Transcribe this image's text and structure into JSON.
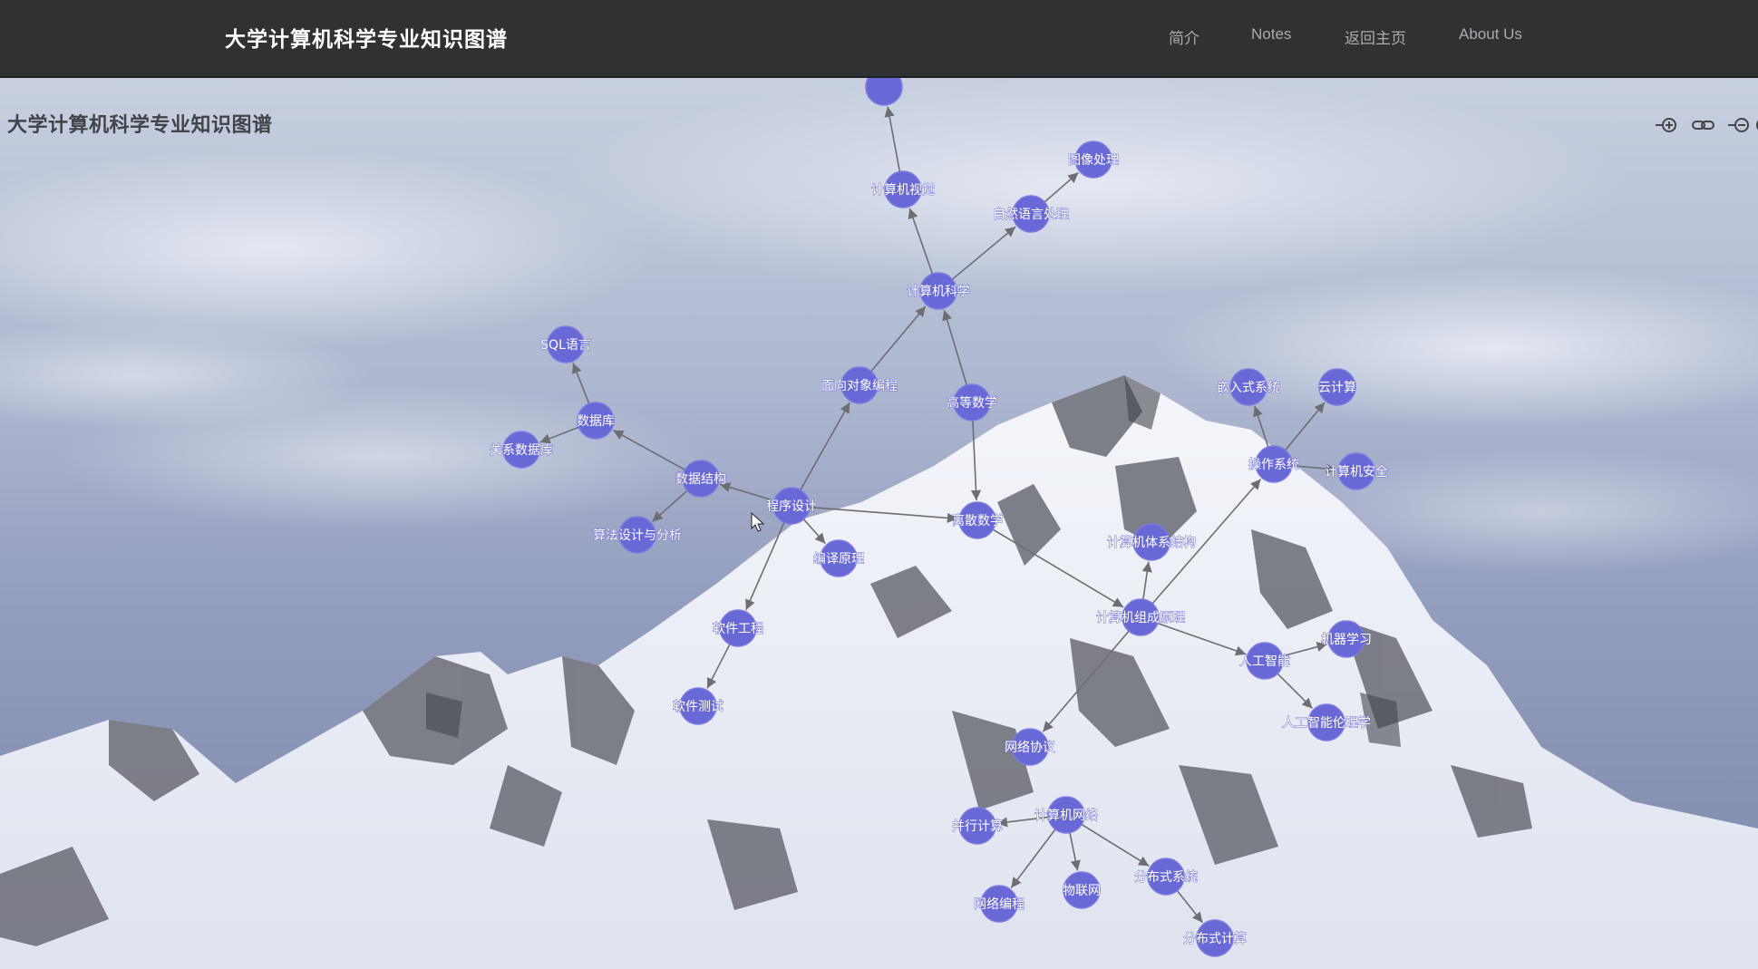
{
  "navbar": {
    "brand": "大学计算机科学专业知识图谱",
    "links": [
      "简介",
      "Notes",
      "返回主页",
      "About Us"
    ]
  },
  "page_title": "大学计算机科学专业知识图谱",
  "toolbar": {
    "icons": [
      "zoom-in-icon",
      "link-icon",
      "zoom-out-icon"
    ]
  },
  "theme": {
    "navbar_bg": "#2f3133",
    "node_color": "#6868d6",
    "edge_color": "#6d6e72"
  },
  "graph": {
    "nodes": [
      {
        "id": "cv_top",
        "label": ""
      },
      {
        "id": "cv",
        "label": "计算机视觉"
      },
      {
        "id": "img",
        "label": "图像处理"
      },
      {
        "id": "nlp",
        "label": "自然语言处理"
      },
      {
        "id": "cs",
        "label": "计算机科学"
      },
      {
        "id": "sql",
        "label": "SQL语言"
      },
      {
        "id": "db",
        "label": "数据库"
      },
      {
        "id": "rdb",
        "label": "关系数据库"
      },
      {
        "id": "oop",
        "label": "面向对象编程"
      },
      {
        "id": "hmath",
        "label": "高等数学"
      },
      {
        "id": "ds",
        "label": "数据结构"
      },
      {
        "id": "prog",
        "label": "程序设计"
      },
      {
        "id": "algo",
        "label": "算法设计与分析"
      },
      {
        "id": "compiler",
        "label": "编译原理"
      },
      {
        "id": "dmath",
        "label": "离散数学"
      },
      {
        "id": "emb",
        "label": "嵌入式系统"
      },
      {
        "id": "cloud",
        "label": "云计算"
      },
      {
        "id": "os",
        "label": "操作系统"
      },
      {
        "id": "sec",
        "label": "计算机安全"
      },
      {
        "id": "arch",
        "label": "计算机体系结构"
      },
      {
        "id": "se",
        "label": "软件工程"
      },
      {
        "id": "co",
        "label": "计算机组成原理"
      },
      {
        "id": "ml",
        "label": "机器学习"
      },
      {
        "id": "ai",
        "label": "人工智能"
      },
      {
        "id": "aiethics",
        "label": "人工智能伦理学"
      },
      {
        "id": "test",
        "label": "软件测试"
      },
      {
        "id": "proto",
        "label": "网络协议"
      },
      {
        "id": "par",
        "label": "并行计算"
      },
      {
        "id": "net",
        "label": "计算机网络"
      },
      {
        "id": "distsys",
        "label": "分布式系统"
      },
      {
        "id": "iot",
        "label": "物联网"
      },
      {
        "id": "netprog",
        "label": "网络编程"
      },
      {
        "id": "distcomp",
        "label": "分布式计算"
      }
    ],
    "edges": [
      [
        "cv",
        "cv_top"
      ],
      [
        "cs",
        "cv"
      ],
      [
        "cs",
        "nlp"
      ],
      [
        "nlp",
        "img"
      ],
      [
        "oop",
        "cs"
      ],
      [
        "hmath",
        "cs"
      ],
      [
        "hmath",
        "dmath"
      ],
      [
        "prog",
        "oop"
      ],
      [
        "prog",
        "ds"
      ],
      [
        "prog",
        "dmath"
      ],
      [
        "prog",
        "compiler"
      ],
      [
        "prog",
        "se"
      ],
      [
        "ds",
        "db"
      ],
      [
        "ds",
        "algo"
      ],
      [
        "db",
        "sql"
      ],
      [
        "db",
        "rdb"
      ],
      [
        "se",
        "test"
      ],
      [
        "dmath",
        "co"
      ],
      [
        "co",
        "arch"
      ],
      [
        "co",
        "os"
      ],
      [
        "co",
        "ai"
      ],
      [
        "co",
        "proto"
      ],
      [
        "os",
        "emb"
      ],
      [
        "os",
        "cloud"
      ],
      [
        "os",
        "sec"
      ],
      [
        "ai",
        "ml"
      ],
      [
        "ai",
        "aiethics"
      ],
      [
        "net",
        "par"
      ],
      [
        "net",
        "iot"
      ],
      [
        "net",
        "distsys"
      ],
      [
        "net",
        "netprog"
      ],
      [
        "distsys",
        "distcomp"
      ]
    ]
  }
}
